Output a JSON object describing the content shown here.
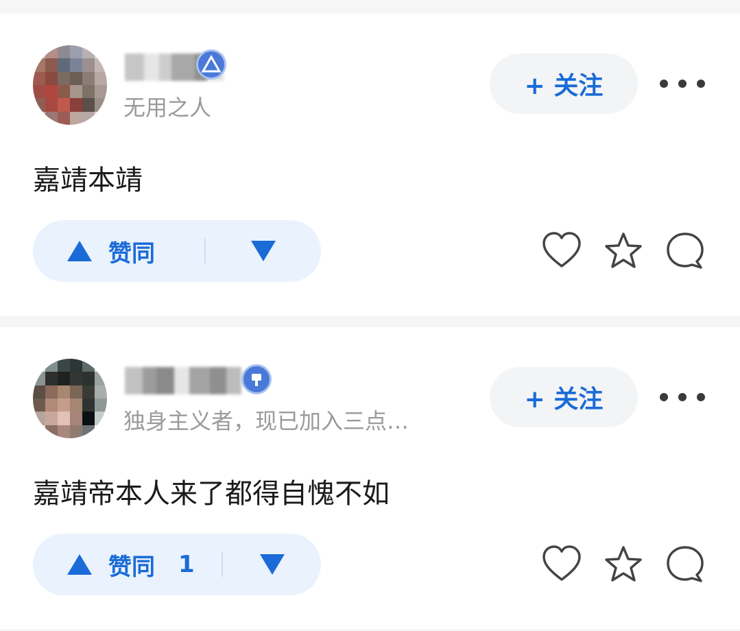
{
  "answers": [
    {
      "author_bio": "无用之人",
      "follow_label": "+ 关注",
      "content": "嘉靖本靖",
      "upvote_label": "赞同",
      "upvote_count": ""
    },
    {
      "author_bio": "独身主义者，现已加入三点…",
      "follow_label": "+ 关注",
      "content": "嘉靖帝本人来了都得自愧不如",
      "upvote_label": "赞同",
      "upvote_count": "1"
    }
  ],
  "icons": {
    "more": "more-dots-icon",
    "like": "heart-icon",
    "favorite": "star-icon",
    "comment": "comment-bubble-icon",
    "upvote": "triangle-up-icon",
    "downvote": "triangle-down-icon",
    "badge": "verified-badge-icon"
  },
  "colors": {
    "accent": "#1a6bd8",
    "vote_bg": "#eaf2fd",
    "follow_bg": "#f3f4f6",
    "muted_text": "#9a9a9a",
    "icon_stroke": "#444444"
  }
}
